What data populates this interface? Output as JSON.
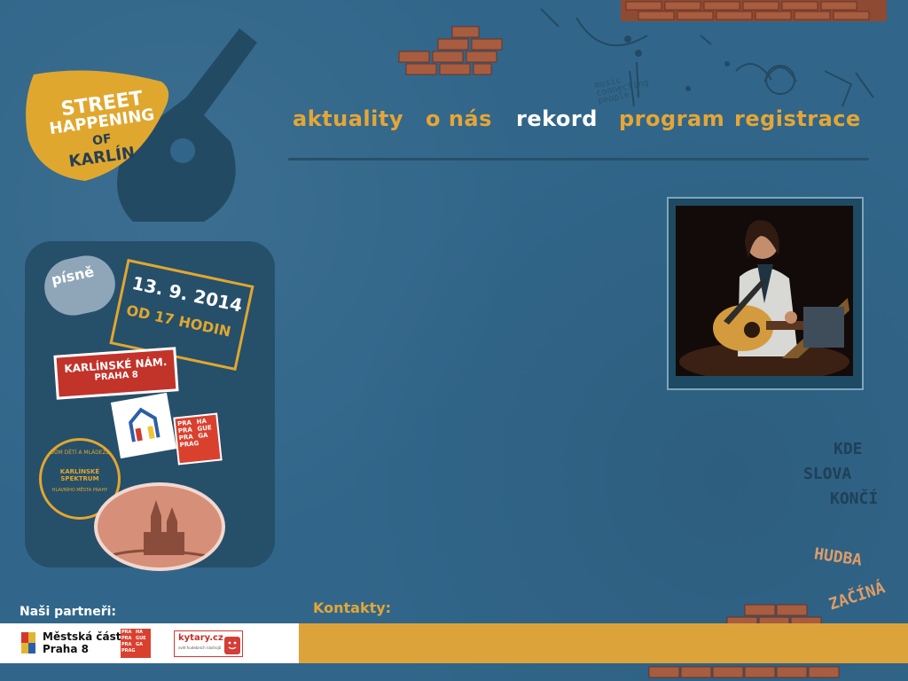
{
  "nav": {
    "items": [
      {
        "label": "aktuality",
        "active": false
      },
      {
        "label": "o nás",
        "active": false
      },
      {
        "label": "rekord",
        "active": true
      },
      {
        "label": "program",
        "active": false
      },
      {
        "label": "registrace",
        "active": false
      }
    ]
  },
  "logo": {
    "line1": "STREET",
    "line2": "HAPPENING",
    "line3": "OF",
    "line4": "KARLÍN"
  },
  "stickers": {
    "pisne": "písně",
    "date": "13. 9. 2014",
    "time": "OD 17 HODIN",
    "place": "KARLÍNSKÉ NÁM.",
    "district": "PRAHA 8",
    "prague_logo": [
      "PRA",
      "HA",
      "PRA",
      "GUE",
      "PRA",
      "GA",
      "PRAG"
    ],
    "spektrum_top": "DŮM DĚTÍ A MLÁDEŽE",
    "spektrum_mid": "KARLÍNSKÉ SPEKTRUM",
    "spektrum_bottom": "HLAVNÍHO MĚSTA PRAHY"
  },
  "wall_text": {
    "music": "music connecting people",
    "slogan1_a": "KDE",
    "slogan1_b": "SLOVA",
    "slogan1_c": "KONČÍ",
    "slogan2_a": "HUDBA",
    "slogan2_b": "ZAČÍNÁ"
  },
  "partners": {
    "label": "Naši partneři:",
    "city_line1": "Městská část",
    "city_line2": "Praha 8",
    "kytary": "kytary.cz",
    "kytary_sub": "svět hudebních nástrojů",
    "prague": [
      "PRA",
      "HA",
      "PRA",
      "GUE",
      "PRA",
      "GA",
      "PRAG"
    ]
  },
  "contacts": {
    "label": "Kontakty:"
  },
  "colors": {
    "background": "#31668a",
    "accent": "#e4a637",
    "active": "#ffffff",
    "brick": "#a45a3e"
  }
}
